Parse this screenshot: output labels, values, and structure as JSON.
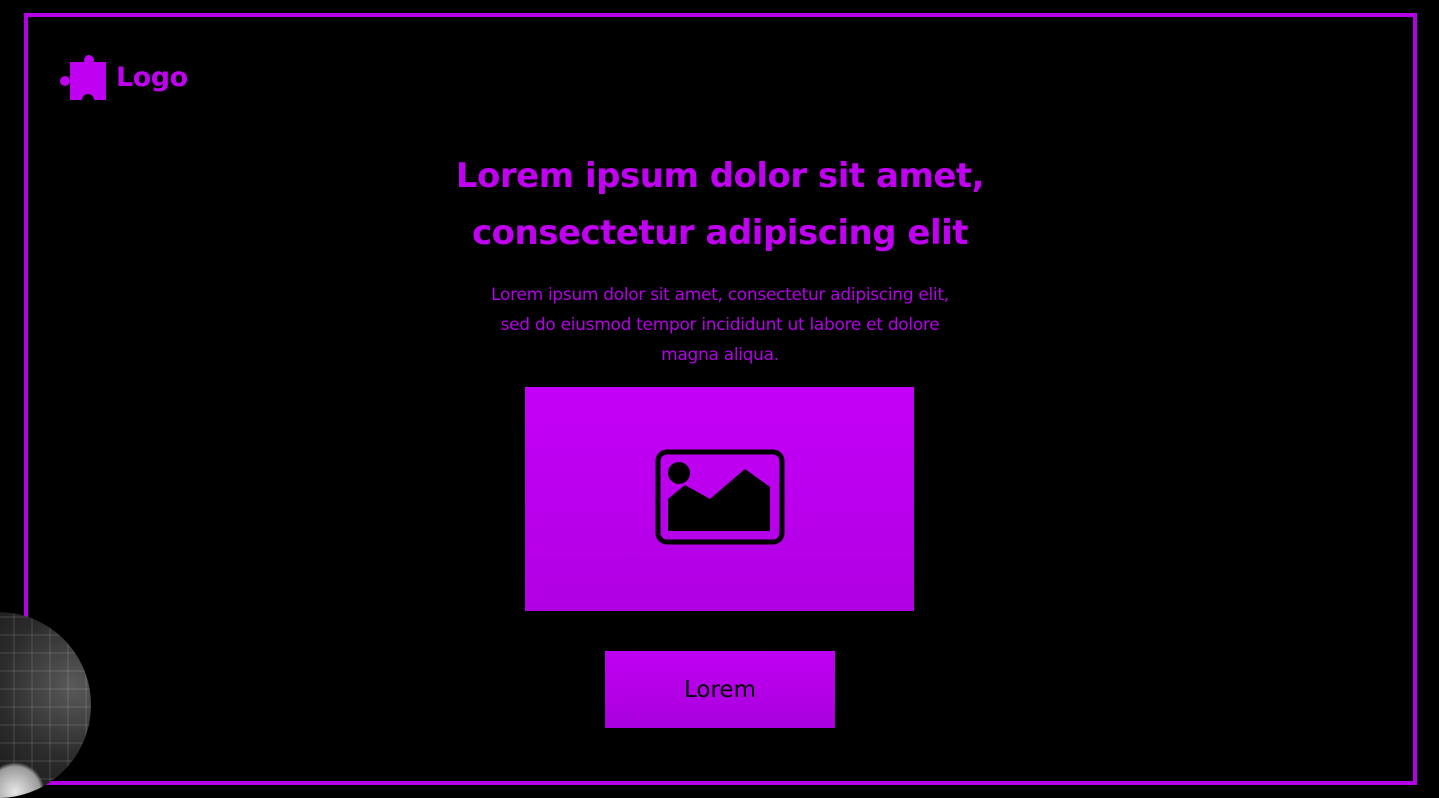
{
  "logo": {
    "text": "Logo",
    "icon": "puzzle-piece-icon"
  },
  "hero": {
    "headline_line1": "Lorem ipsum dolor sit amet,",
    "headline_line2": "consectetur adipiscing elit",
    "subtext_line1": "Lorem ipsum dolor sit amet, consectetur adipiscing elit,",
    "subtext_line2": "sed do eiusmod tempor incididunt ut labore et dolore",
    "subtext_line3": "magna aliqua."
  },
  "media": {
    "icon": "image-placeholder-icon"
  },
  "cta": {
    "label": "Lorem"
  },
  "colors": {
    "background": "#000000",
    "accent": "#c000f0",
    "frame": "#b400e6",
    "button_text": "#000000"
  }
}
